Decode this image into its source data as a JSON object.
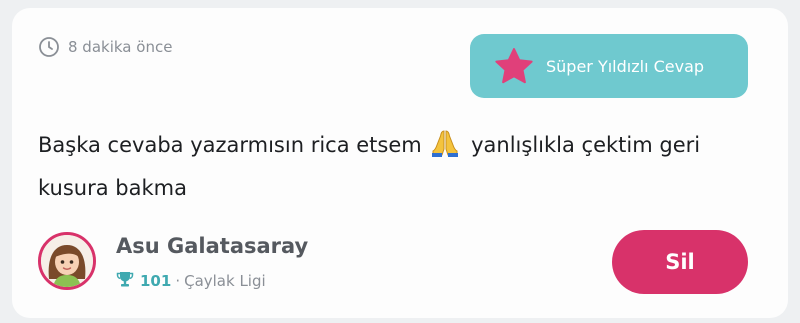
{
  "answer": {
    "time_ago": "8 dakika önce",
    "super_star_label": "Süper Yıldızlı Cevap",
    "text_part1": "Başka cevaba yazarmısın rica etsem",
    "emoji": "🙏",
    "text_part2": "yanlışlıkla çektim geri kusura bakma"
  },
  "user": {
    "name": "Asu Galatasaray",
    "points": "101",
    "separator": "·",
    "league": "Çaylak Ligi"
  },
  "actions": {
    "delete_label": "Sil"
  },
  "icons": {
    "clock": "clock-icon",
    "star": "star-icon",
    "trophy": "trophy-icon",
    "emoji": "folded-hands-emoji"
  },
  "colors": {
    "super_star_bg": "#6fc9cf",
    "star": "#e0407a",
    "delete_bg": "#d8326a",
    "points": "#3fa9b0"
  }
}
